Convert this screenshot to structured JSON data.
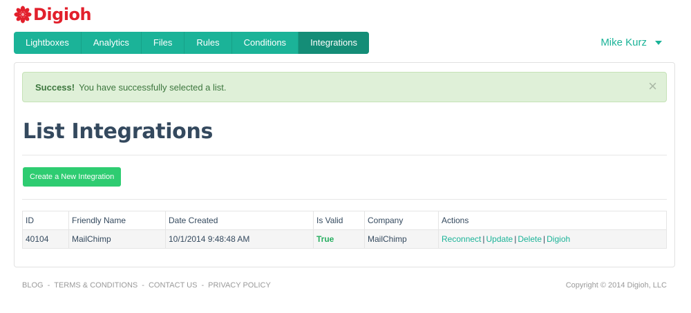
{
  "brand": {
    "name": "Digioh",
    "logo_color": "#e2202c"
  },
  "nav": {
    "items": [
      {
        "label": "Lightboxes"
      },
      {
        "label": "Analytics"
      },
      {
        "label": "Files"
      },
      {
        "label": "Rules"
      },
      {
        "label": "Conditions"
      },
      {
        "label": "Integrations",
        "active": true
      }
    ],
    "accent": "#1bb398"
  },
  "user": {
    "name": "Mike Kurz"
  },
  "alert": {
    "title": "Success!",
    "message": "You have successfully selected a list.",
    "close": "×"
  },
  "page": {
    "title": "List Integrations",
    "create_label": "Create a New Integration"
  },
  "table": {
    "headers": [
      "ID",
      "Friendly Name",
      "Date Created",
      "Is Valid",
      "Company",
      "Actions"
    ],
    "rows": [
      {
        "id": "40104",
        "friendly_name": "MailChimp",
        "date_created": "10/1/2014 9:48:48 AM",
        "is_valid": "True",
        "company": "MailChimp",
        "actions": [
          "Reconnect",
          "Update",
          "Delete",
          "Digioh"
        ]
      }
    ]
  },
  "footer": {
    "links": [
      "BLOG",
      "TERMS & CONDITIONS",
      "CONTACT US",
      "PRIVACY POLICY"
    ],
    "separator": "-",
    "copyright": "Copyright © 2014 Digioh, LLC"
  }
}
